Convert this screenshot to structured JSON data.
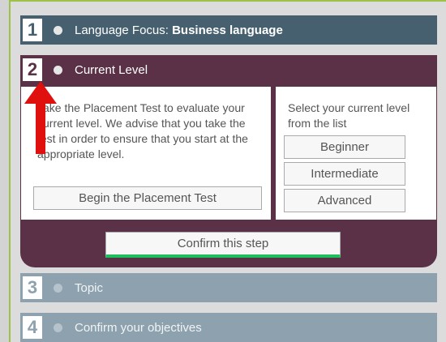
{
  "steps": [
    {
      "number": "1",
      "label_prefix": "Language Focus: ",
      "label_bold": "Business language"
    },
    {
      "number": "2",
      "label": "Current Level"
    },
    {
      "number": "3",
      "label": "Topic"
    },
    {
      "number": "4",
      "label": "Confirm your objectives"
    }
  ],
  "current_level": {
    "placement_text": "Take the Placement Test to evaluate your current level. We advise that you take the test in order to ensure that you start at the appropriate level.",
    "placement_button": "Begin the Placement Test",
    "select_text": "Select your current level from the list",
    "levels": [
      "Beginner",
      "Intermediate",
      "Advanced"
    ],
    "confirm_button": "Confirm this step"
  },
  "colors": {
    "step1": "#46606f",
    "step2": "#5a3146",
    "inactive": "#8ea1ae",
    "arrow": "#e0100f",
    "confirm_underline": "#1dbf5c"
  }
}
